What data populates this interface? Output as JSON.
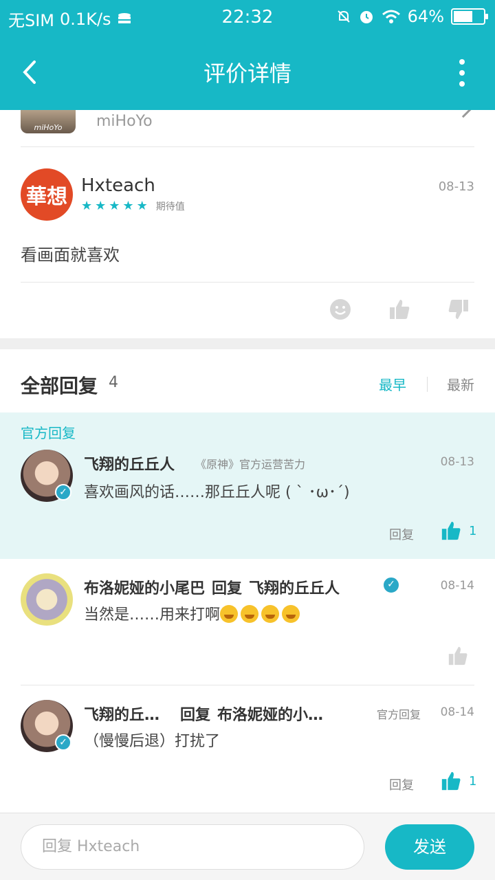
{
  "status_bar": {
    "carrier": "无SIM",
    "speed": "0.1K/s",
    "time": "22:32",
    "battery": "64%",
    "battery_level": 0.64
  },
  "header": {
    "title": "评价详情",
    "back_icon": "chevron-left-icon",
    "more_icon": "more-vertical-icon"
  },
  "game": {
    "icon_label": "miHoYo",
    "developer": "miHoYo"
  },
  "review": {
    "avatar_text": "華想",
    "author": "Hxteach",
    "rating": 5,
    "stars": [
      "★",
      "★",
      "★",
      "★",
      "★"
    ],
    "tag": "期待值",
    "date": "08-13",
    "text": "看画面就喜欢"
  },
  "replies": {
    "title": "全部回复",
    "count": "4",
    "sort_earliest": "最早",
    "sort_latest": "最新",
    "official_label": "官方回复",
    "items": [
      {
        "name": "飞翔的丘丘人",
        "role": "《原神》官方运营苦力",
        "date": "08-13",
        "text": "喜欢画风的话……那丘丘人呢 ( ` ･ω･´)",
        "reply_label": "回复",
        "likes": "1"
      },
      {
        "name": "布洛妮娅的小尾巴",
        "reply_word": "回复",
        "target": "飞翔的丘丘人",
        "date": "08-14",
        "text": "当然是……用来打啊"
      },
      {
        "name": "飞翔的丘…",
        "reply_word": "回复",
        "target": "布洛妮娅的小…",
        "badge": "官方回复",
        "date": "08-14",
        "text": "（慢慢后退）打扰了",
        "reply_label": "回复",
        "likes": "1"
      }
    ]
  },
  "input": {
    "placeholder": "回复 Hxteach",
    "send_label": "发送"
  },
  "colors": {
    "accent": "#17b8c6",
    "official_bg": "#e5f6f6"
  }
}
